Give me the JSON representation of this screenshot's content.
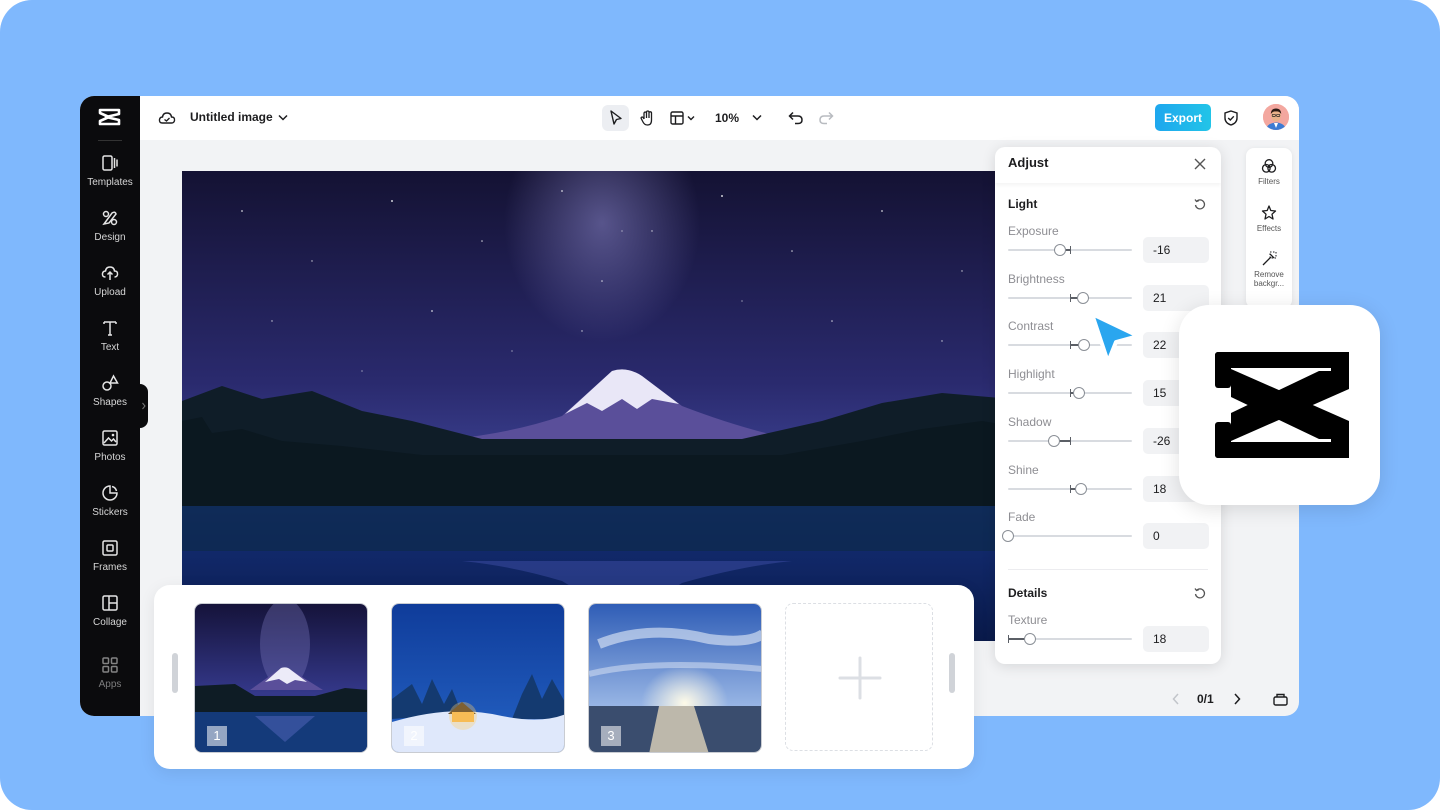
{
  "header": {
    "doc_title": "Untitled image",
    "zoom": "10%",
    "export_label": "Export"
  },
  "rail": {
    "items": [
      {
        "label": "Templates",
        "icon": "templates-icon"
      },
      {
        "label": "Design",
        "icon": "design-icon"
      },
      {
        "label": "Upload",
        "icon": "upload-icon"
      },
      {
        "label": "Text",
        "icon": "text-icon"
      },
      {
        "label": "Shapes",
        "icon": "shapes-icon"
      },
      {
        "label": "Photos",
        "icon": "photos-icon"
      },
      {
        "label": "Stickers",
        "icon": "stickers-icon"
      },
      {
        "label": "Frames",
        "icon": "frames-icon"
      },
      {
        "label": "Collage",
        "icon": "collage-icon"
      },
      {
        "label": "Apps",
        "icon": "apps-icon"
      }
    ]
  },
  "side_tools": [
    {
      "label": "Filters",
      "icon": "filters-icon"
    },
    {
      "label": "Effects",
      "icon": "effects-icon"
    },
    {
      "label": "Remove backgr...",
      "icon": "remove-background-icon"
    }
  ],
  "adjust": {
    "title": "Adjust",
    "light": {
      "title": "Light",
      "params": [
        {
          "label": "Exposure",
          "value": "-16",
          "level": -16
        },
        {
          "label": "Brightness",
          "value": "21",
          "level": 21
        },
        {
          "label": "Contrast",
          "value": "22",
          "level": 22
        },
        {
          "label": "Highlight",
          "value": "15",
          "level": 15
        },
        {
          "label": "Shadow",
          "value": "-26",
          "level": -26
        },
        {
          "label": "Shine",
          "value": "18",
          "level": 18
        },
        {
          "label": "Fade",
          "value": "0",
          "level": 0,
          "min_zero": true
        }
      ]
    },
    "details": {
      "title": "Details",
      "params": [
        {
          "label": "Texture",
          "value": "18",
          "level": 18,
          "min_zero": true
        }
      ]
    }
  },
  "pager": {
    "text": "0/1"
  },
  "thumbnails": [
    {
      "number": "1",
      "scene": "mountain-night"
    },
    {
      "number": "2",
      "scene": "snow-cabin"
    },
    {
      "number": "3",
      "scene": "sunset-sea"
    }
  ],
  "colors": {
    "background": "#7fb8fd",
    "rail": "#0b0b0d",
    "accent": "#1ea7ee",
    "cursor": "#2aa6ef"
  }
}
